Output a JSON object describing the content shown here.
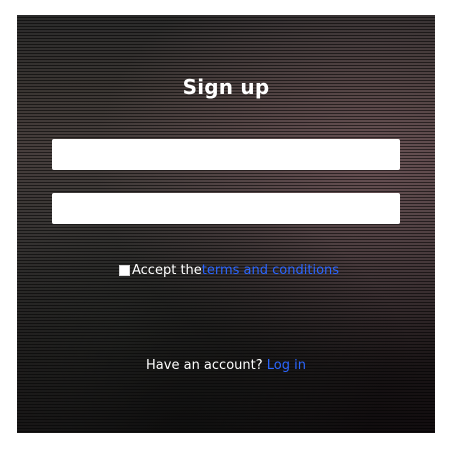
{
  "form": {
    "title": "Sign up",
    "fields": [
      {
        "value": "",
        "placeholder": ""
      },
      {
        "value": "",
        "placeholder": ""
      }
    ],
    "terms": {
      "prefix": "Accept the ",
      "link_text": "terms and conditions"
    },
    "account": {
      "prefix": "Have an account? ",
      "link_text": "Log in"
    }
  },
  "colors": {
    "link": "#2b66ff",
    "text": "#ffffff",
    "input_bg": "#ffffff"
  }
}
